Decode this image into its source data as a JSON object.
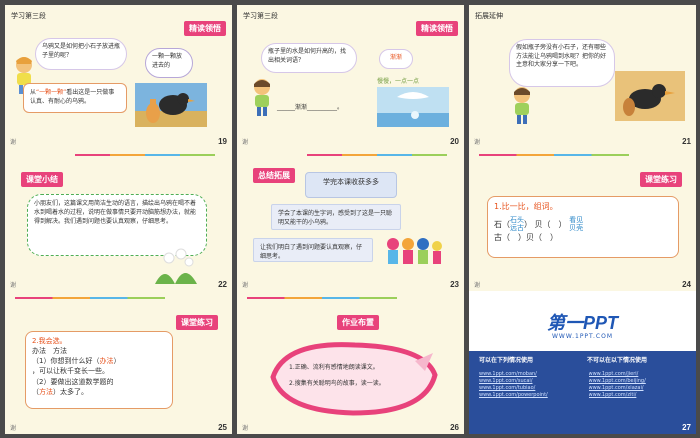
{
  "slides": [
    {
      "num": "19",
      "foot": "谢",
      "label": "学习第三段",
      "badge": "精读领悟",
      "question": "乌鸦又是如何把小石子放进瓶子里的呢？",
      "bubble2": "一颗一颗放进去的",
      "answer_pre": "从",
      "answer_q": "“一颗一颗”",
      "answer_post": "看出这是一只做事认真、有耐心的乌鸦。"
    },
    {
      "num": "20",
      "foot": "谢",
      "label": "学习第三段",
      "badge": "精读领悟",
      "question": "瓶子里的水是如何升高的，找出相关词语？",
      "bubble2": "渐渐",
      "slow": "慢慢，一点一点",
      "blank_word": "渐渐"
    },
    {
      "num": "21",
      "foot": "谢",
      "label": "拓展延伸",
      "question": "假如瓶子旁没有小石子，还有哪些方法能让乌鸦喝到水呢？把你的好主意和大家分享一下吧。"
    },
    {
      "num": "22",
      "foot": "谢",
      "badge": "课堂小结",
      "body": "小朋友们，这篇课文用简洁生动的语言，描绘出乌鸦在喝不着水到喝着水的过程，说明在做事情只要开动脑筋想办法，就能得到解决。我们遇到问题也要认真观察，仔细思考。"
    },
    {
      "num": "23",
      "foot": "谢",
      "badge": "总结拓展",
      "cap": "学完本课收获多多",
      "item1": "学会了本课的生字词，感受到了这是一只聪明又能干的小乌鸦。",
      "item2": "让我们明白了遇到问题要认真观察，仔细思考。"
    },
    {
      "num": "24",
      "foot": "谢",
      "badge": "课堂练习",
      "title": "1.比一比，组词。",
      "c1": "石",
      "c1a": "石头",
      "c1b": "远古",
      "c2": "贝",
      "c2a": "看见",
      "c2b": "贝壳",
      "d1": "古",
      "d2": "贝"
    },
    {
      "num": "25",
      "foot": "谢",
      "badge": "课堂练习",
      "title": "2.我会选。",
      "opts": "办法　方法",
      "l1": "（1）你想到什么好（",
      "a1": "办法",
      "l1e": "）",
      "l2": "，可以让秋千变长一些。",
      "l3": "（2）要做出这道数学题的",
      "l4": "（",
      "a2": "方法",
      "l4e": "）太多了。"
    },
    {
      "num": "26",
      "foot": "谢",
      "badge": "作业布置",
      "hw1": "1.正确、流利有感情地朗读课文。",
      "hw2": "2.搜集有关聪明鸟的故事，读一读。"
    },
    {
      "num": "27",
      "foot": "谢",
      "logo": "第一PPT",
      "url": "WWW.1PPT.COM",
      "col1": "可以在下列情况使用",
      "col2": "不可以在以下情况使用",
      "links": [
        "www.1ppt.com/moban/",
        "www.1ppt.com/jieri/",
        "www.1ppt.com/sucai/",
        "www.1ppt.com/beijing/",
        "www.1ppt.com/tubiao/",
        "www.1ppt.com/xiazai/",
        "www.1ppt.com/powerpoint/",
        "www.1ppt.com/ziti/"
      ]
    }
  ],
  "colors": {
    "pink": "#e8427b",
    "bg": "#fbf7e2",
    "orange": "#e7521c",
    "blue": "#2a4e9b"
  }
}
